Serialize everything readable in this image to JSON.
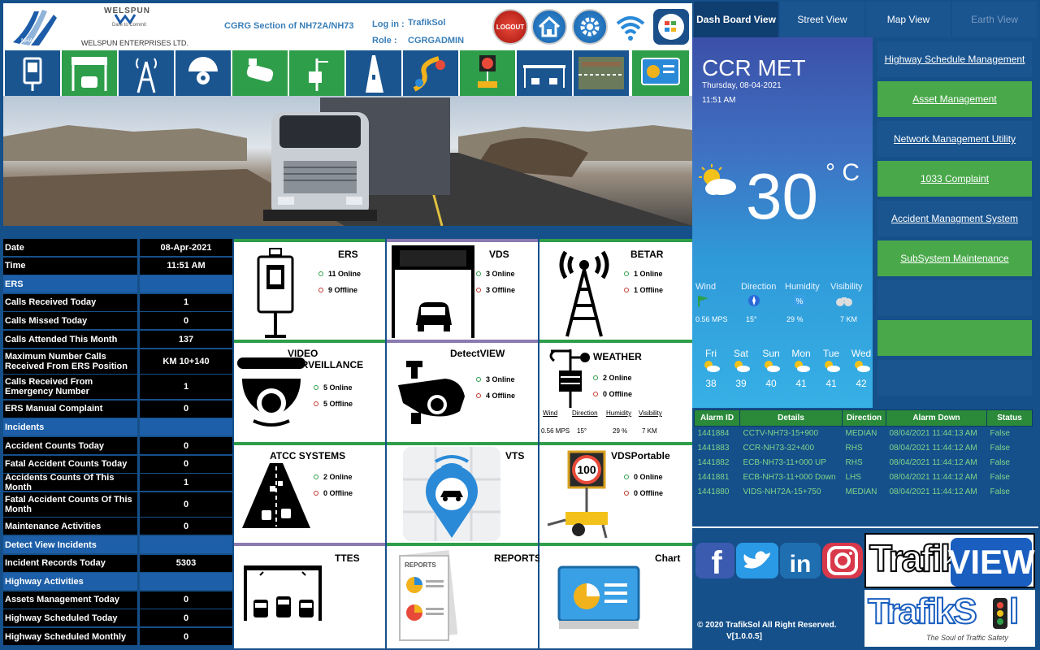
{
  "header": {
    "brand_top": "WELSPUN",
    "brand_sub": "Dare to Commit",
    "brand_name": "WELSPUN ENTERPRISES LTD.",
    "section_title": "CGRG Section of NH72A/NH73",
    "login_label": "Log in :",
    "login_value": "TrafikSol",
    "role_label": "Role   :",
    "role_value": "CGRGADMIN",
    "logout_label": "LOGOUT"
  },
  "tabs": [
    "Dash Board View",
    "Street View",
    "Map View",
    "Earth View"
  ],
  "left_table": [
    {
      "label": "Date",
      "value": "08-Apr-2021",
      "section": false
    },
    {
      "label": "Time",
      "value": "11:51 AM",
      "section": false
    },
    {
      "label": "ERS",
      "value": "",
      "section": true
    },
    {
      "label": "Calls Received Today",
      "value": "1",
      "section": false
    },
    {
      "label": "Calls Missed Today",
      "value": "0",
      "section": false
    },
    {
      "label": "Calls Attended This Month",
      "value": "137",
      "section": false
    },
    {
      "label": "Maximum Number Calls Received From ERS Position",
      "value": "KM 10+140",
      "section": false,
      "tall": true
    },
    {
      "label": "Calls Received From Emergency Number",
      "value": "1",
      "section": false,
      "tall": true
    },
    {
      "label": "ERS Manual Complaint",
      "value": "0",
      "section": false
    },
    {
      "label": "Incidents",
      "value": "",
      "section": true
    },
    {
      "label": "Accident Counts Today",
      "value": "0",
      "section": false
    },
    {
      "label": "Fatal Accident Counts Today",
      "value": "0",
      "section": false
    },
    {
      "label": "Accidents Counts Of This Month",
      "value": "1",
      "section": false
    },
    {
      "label": "Fatal Accident Counts Of This Month",
      "value": "0",
      "section": false,
      "tall": true
    },
    {
      "label": "Maintenance Activities",
      "value": "0",
      "section": false
    },
    {
      "label": "Detect View Incidents",
      "value": "",
      "section": true
    },
    {
      "label": "Incident Records Today",
      "value": "5303",
      "section": false
    },
    {
      "label": "Highway Activities",
      "value": "",
      "section": true
    },
    {
      "label": "Assets Management Today",
      "value": "0",
      "section": false
    },
    {
      "label": "Highway Scheduled Today",
      "value": "0",
      "section": false
    },
    {
      "label": "Highway Scheduled Monthly",
      "value": "0",
      "section": false
    }
  ],
  "tiles": {
    "ers": {
      "title": "ERS",
      "online": "11 Online",
      "offline": "9 Offline"
    },
    "vds": {
      "title": "VDS",
      "online": "3 Online",
      "offline": "3 Offline"
    },
    "betar": {
      "title": "BETAR",
      "online": "1 Online",
      "offline": "1 Offline"
    },
    "video": {
      "title1": "VIDEO",
      "title2": "SURVEILLANCE",
      "online": "5 Online",
      "offline": "5 Offline"
    },
    "detect": {
      "title": "DetectVIEW",
      "online": "3 Online",
      "offline": "4 Offline"
    },
    "weather": {
      "title": "WEATHER",
      "online": "2 Online",
      "offline": "0 Offline",
      "h_wind": "Wind",
      "h_dir": "Direction",
      "h_hum": "Humidity",
      "h_vis": "Visibility",
      "v_wind": "0.56 MPS",
      "v_dir": "15°",
      "v_hum": "29 %",
      "v_vis": "7 KM"
    },
    "atcc": {
      "title": "ATCC SYSTEMS",
      "online": "2 Online",
      "offline": "0 Offline"
    },
    "vts": {
      "title": "VTS"
    },
    "vdsportable": {
      "title": "VDSPortable",
      "online": "0 Online",
      "offline": "0 Offline",
      "sign": "100"
    },
    "ttes": {
      "title": "TTES"
    },
    "reports": {
      "title": "REPORTS",
      "doc_label": "REPORTS"
    },
    "chart": {
      "title": "Chart"
    }
  },
  "weather_panel": {
    "location": "CCR MET",
    "date": "Thursday, 08-04-2021",
    "time": "11:51 AM",
    "temp": "30",
    "unit": "° C",
    "labels": [
      "Wind",
      "Direction",
      "Humidity",
      "Visibility"
    ],
    "values": [
      "0.56 MPS",
      "15°",
      "29 %",
      "7 KM"
    ],
    "forecast": [
      {
        "day": "Fri",
        "temp": "38"
      },
      {
        "day": "Sat",
        "temp": "39"
      },
      {
        "day": "Sun",
        "temp": "40"
      },
      {
        "day": "Mon",
        "temp": "41"
      },
      {
        "day": "Tue",
        "temp": "41"
      },
      {
        "day": "Wed",
        "temp": "42"
      }
    ]
  },
  "nav_buttons": [
    {
      "label": "Highway Schedule Management",
      "color": "#1a5590"
    },
    {
      "label": "Asset Management",
      "color": "#49a84a"
    },
    {
      "label": "Network Management Utility",
      "color": "#1a5590"
    },
    {
      "label": "1033 Complaint",
      "color": "#49a84a"
    },
    {
      "label": "Accident Managment System",
      "color": "#1a5590"
    },
    {
      "label": "SubSystem Maintenance",
      "color": "#49a84a"
    },
    {
      "label": "",
      "color": "#1a5590"
    },
    {
      "label": "",
      "color": "#49a84a"
    },
    {
      "label": "",
      "color": "#1a5590"
    }
  ],
  "alarms": {
    "headers": [
      "Alarm ID",
      "Details",
      "Direction",
      "Alarm Down",
      "Status"
    ],
    "rows": [
      [
        "1441884",
        "CCTV-NH73-15+900",
        "MEDIAN",
        "08/04/2021 11:44:13 AM",
        "False"
      ],
      [
        "1441883",
        "CCR-NH73-32+400",
        "RHS",
        "08/04/2021 11:44:12 AM",
        "False"
      ],
      [
        "1441882",
        "ECB-NH73-11+000 UP",
        "RHS",
        "08/04/2021 11:44:12 AM",
        "False"
      ],
      [
        "1441881",
        "ECB-NH73-11+000 Down",
        "LHS",
        "08/04/2021 11:44:12 AM",
        "False"
      ],
      [
        "1441880",
        "VIDS-NH72A-15+750",
        "MEDIAN",
        "08/04/2021 11:44:12 AM",
        "False"
      ]
    ]
  },
  "footer": {
    "copyright": "© 2020 TrafikSol All Right Reserved.",
    "version": "V[1.0.0.5]",
    "brand1_a": "Trafik",
    "brand1_b": "VIEW",
    "brand2": "TrafikS",
    "brand2_end": "l",
    "tagline": "The Soul of Traffic Safety"
  },
  "colors": {
    "accent_blue": "#1a5590",
    "accent_green": "#49a84a",
    "bg": "#15508a"
  }
}
